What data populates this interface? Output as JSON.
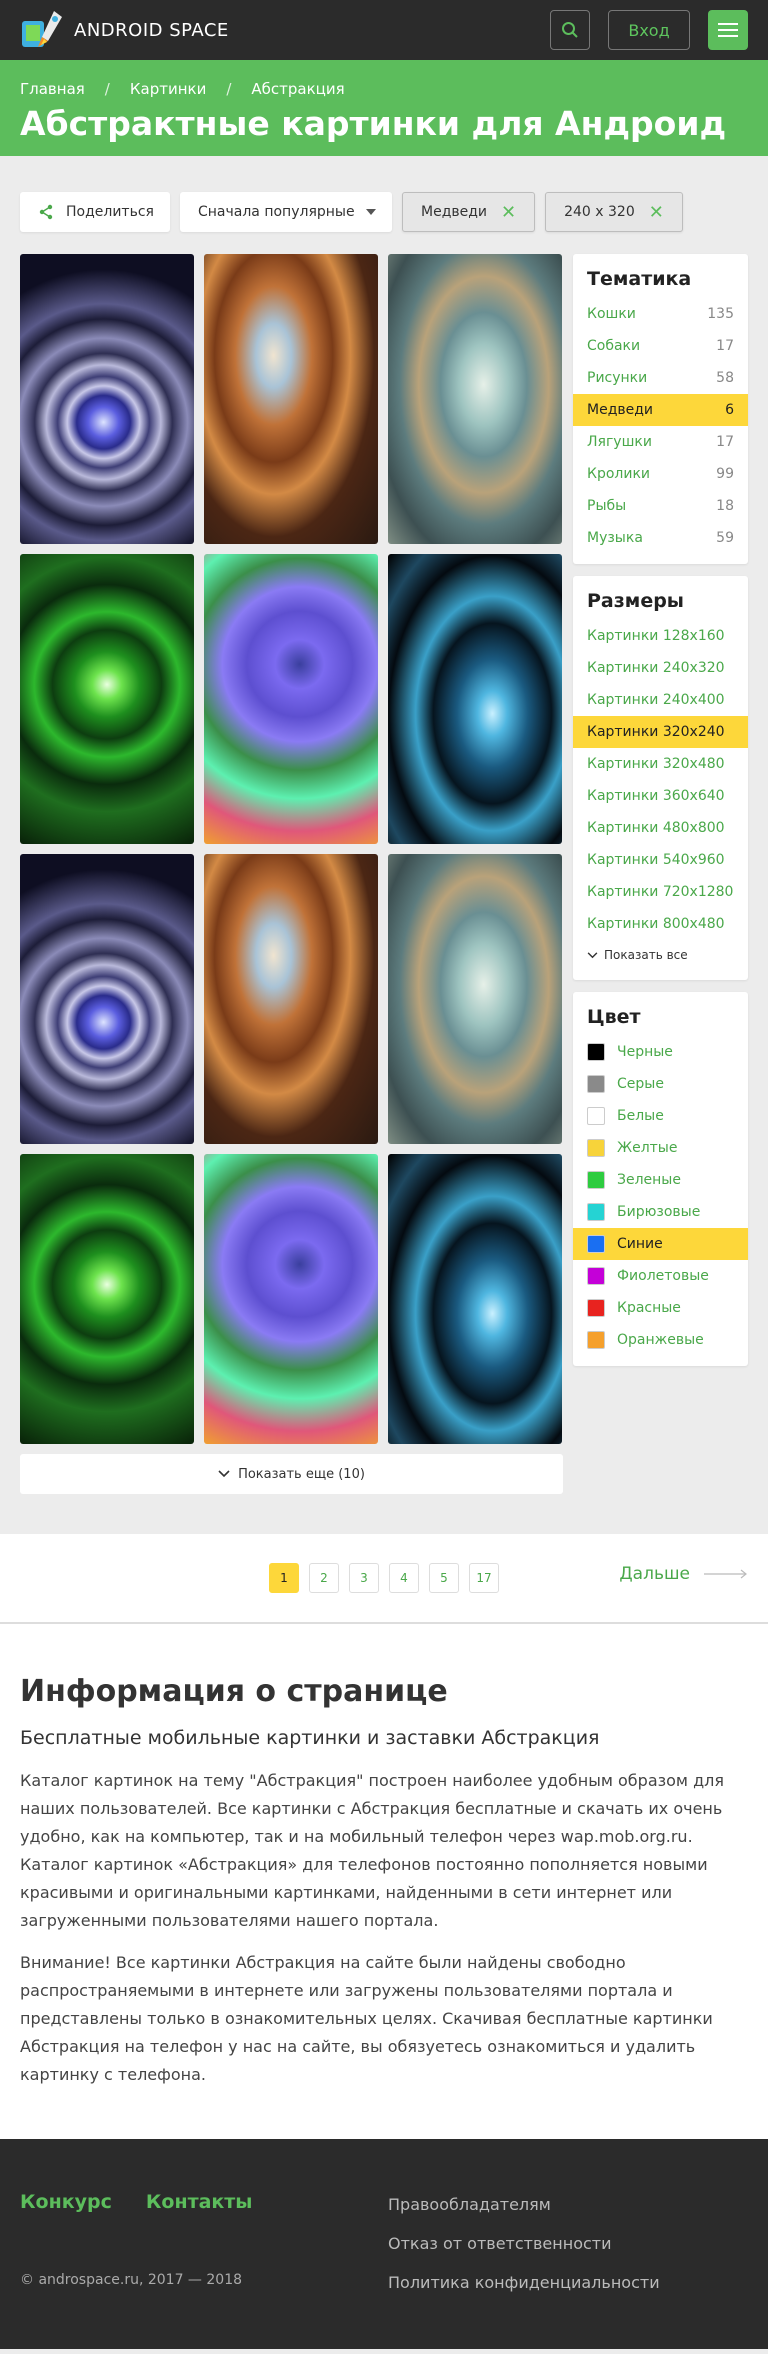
{
  "header": {
    "logo_text": "ANDROID SPACE",
    "login_label": "Вход",
    "search_icon": "search-icon",
    "menu_icon": "hamburger-icon"
  },
  "breadcrumb": {
    "items": [
      "Главная",
      "Картинки",
      "Абстракция"
    ],
    "separator": "/"
  },
  "page_title": "Абстрактные картинки для Андроид",
  "controls": {
    "share_label": "Поделиться",
    "sort_label": "Сначала популярные",
    "tags": [
      "Медведи",
      "240 x 320"
    ]
  },
  "gallery": {
    "tiles": [
      "eye",
      "fire",
      "frost",
      "green",
      "flower",
      "cyan",
      "eye",
      "fire",
      "frost",
      "green",
      "flower",
      "cyan"
    ],
    "show_more_label": "Показать еще (10)"
  },
  "sidebar": {
    "topics": {
      "title": "Тематика",
      "items": [
        {
          "label": "Кошки",
          "count": "135",
          "active": false
        },
        {
          "label": "Собаки",
          "count": "17",
          "active": false
        },
        {
          "label": "Рисунки",
          "count": "58",
          "active": false
        },
        {
          "label": "Медведи",
          "count": "6",
          "active": true
        },
        {
          "label": "Лягушки",
          "count": "17",
          "active": false
        },
        {
          "label": "Кролики",
          "count": "99",
          "active": false
        },
        {
          "label": "Рыбы",
          "count": "18",
          "active": false
        },
        {
          "label": "Музыка",
          "count": "59",
          "active": false
        }
      ]
    },
    "sizes": {
      "title": "Размеры",
      "items": [
        {
          "label": "Картинки 128x160",
          "active": false
        },
        {
          "label": "Картинки 240x320",
          "active": false
        },
        {
          "label": "Картинки 240x400",
          "active": false
        },
        {
          "label": "Картинки 320x240",
          "active": true
        },
        {
          "label": "Картинки 320x480",
          "active": false
        },
        {
          "label": "Картинки 360x640",
          "active": false
        },
        {
          "label": "Картинки 480x800",
          "active": false
        },
        {
          "label": "Картинки 540x960",
          "active": false
        },
        {
          "label": "Картинки 720x1280",
          "active": false
        },
        {
          "label": "Картинки 800x480",
          "active": false
        }
      ],
      "show_all_label": "Показать все"
    },
    "colors": {
      "title": "Цвет",
      "items": [
        {
          "label": "Черные",
          "color": "#000000",
          "active": false
        },
        {
          "label": "Серые",
          "color": "#8a8a8a",
          "active": false
        },
        {
          "label": "Белые",
          "color": "#ffffff",
          "active": false
        },
        {
          "label": "Желтые",
          "color": "#f7d33a",
          "active": false
        },
        {
          "label": "Зеленые",
          "color": "#2ecc40",
          "active": false
        },
        {
          "label": "Бирюзовые",
          "color": "#25d3d3",
          "active": false
        },
        {
          "label": "Синие",
          "color": "#1a6ff2",
          "active": true
        },
        {
          "label": "Фиолетовые",
          "color": "#c400d8",
          "active": false
        },
        {
          "label": "Красные",
          "color": "#e8231f",
          "active": false
        },
        {
          "label": "Оранжевые",
          "color": "#f5a02c",
          "active": false
        }
      ]
    }
  },
  "pagination": {
    "pages": [
      "1",
      "2",
      "3",
      "4",
      "5",
      "17"
    ],
    "current": "1",
    "next_label": "Дальше"
  },
  "info": {
    "title": "Информация о странице",
    "subtitle": "Бесплатные мобильные картинки и заставки Абстракция",
    "paragraph1": "Каталог картинок на тему \"Абстракция\" построен наиболее удобным образом для наших пользователей. Все картинки с Абстракция бесплатные и скачать их очень удобно, как на компьютер, так и на мобильный телефон через wap.mob.org.ru. Каталог картинок «Абстракция» для телефонов постоянно пополняется новыми красивыми и оригинальными картинками, найденными в сети интернет или загруженными пользователями нашего портала.",
    "paragraph2": "Внимание! Все картинки Абстракция на сайте были найдены свободно распространяемыми в интернете или загружены пользователями портала и представлены только в ознакомительных целях. Скачивая бесплатные картинки Абстракция на телефон у нас на сайте, вы обязуетесь ознакомиться и удалить картинку с телефона."
  },
  "footer": {
    "links": [
      "Конкурс",
      "Контакты"
    ],
    "copyright": "© androspace.ru, 2017 — 2018",
    "right_links": [
      "Правообладателям",
      "Отказ от ответственности",
      "Политика конфиденциальности"
    ]
  },
  "colors": {
    "brand_green": "#5cbd5c",
    "active_yellow": "#fdd73a",
    "dark": "#2b2b2b"
  }
}
